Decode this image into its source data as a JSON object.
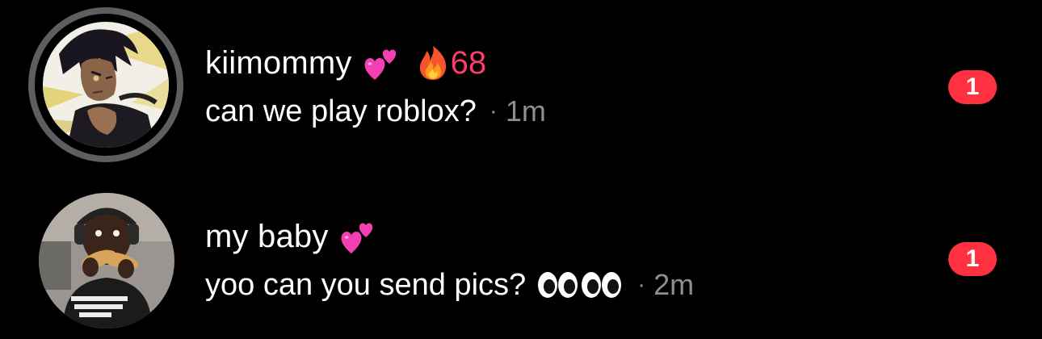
{
  "conversations": [
    {
      "name": "kiimommy",
      "name_emoji": "two-hearts",
      "streak_icon": "fire",
      "streak_count": "68",
      "message": "can we play roblox?",
      "separator": "·",
      "time": "1m",
      "unread_count": "1",
      "has_story_ring": true,
      "avatar": "anime-character-profile-photo"
    },
    {
      "name": "my baby",
      "name_emoji": "two-hearts",
      "message": "yoo can you send pics?",
      "message_emojis": [
        "eyes",
        "eyes"
      ],
      "separator": "·",
      "time": "2m",
      "unread_count": "1",
      "has_story_ring": false,
      "avatar": "person-eating-profile-photo"
    }
  ],
  "colors": {
    "background": "#000000",
    "text": "#ffffff",
    "muted": "#8e8e8e",
    "streak": "#ff3b6b",
    "badge": "#ff3040",
    "story_ring": "#5e5e5e"
  }
}
